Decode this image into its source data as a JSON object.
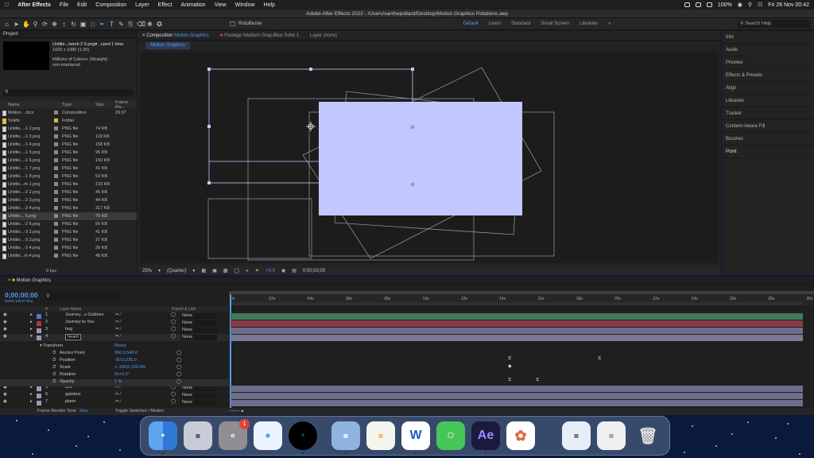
{
  "menubar": {
    "app_name": "After Effects",
    "items": [
      "File",
      "Edit",
      "Composition",
      "Layer",
      "Effect",
      "Animation",
      "View",
      "Window",
      "Help"
    ],
    "battery": "100%",
    "datetime": "Fri 26 Nov  00:42"
  },
  "window_title": "Adobe After Effects 2022 - /Users/xanthepollard/Desktop/Motion Graphics Rotations.aep",
  "toolbar": {
    "rotobezier_label": "RotoBezier",
    "workspaces": [
      {
        "label": "Default",
        "active": true
      },
      {
        "label": "Learn",
        "active": false
      },
      {
        "label": "Standard",
        "active": false
      },
      {
        "label": "Small Screen",
        "active": false
      },
      {
        "label": "Libraries",
        "active": false
      }
    ],
    "search_placeholder": "Search Help"
  },
  "project": {
    "title": "Project",
    "selected_name": "Untitle...twork-2 5.png▾ , used 1 time",
    "info_line1": "1920 x 1080 (1.00)",
    "info_line2": "Millions of Colors+ (Straight)",
    "info_line3": "non-interlaced",
    "columns": {
      "name": "Name",
      "type": "Type",
      "size": "Size",
      "frame": "Frame Ra..."
    },
    "bpc": "8 bpc",
    "items": [
      {
        "name": "Motion ...hics",
        "type": "Composition",
        "size": "",
        "frame": "29.97",
        "color": "#8a8a8a",
        "kind": "comp"
      },
      {
        "name": "Solids",
        "type": "Folder",
        "size": "",
        "frame": "",
        "color": "#d9c04a",
        "kind": "folder"
      },
      {
        "name": "Untitle...-1 2.png",
        "type": "PNG file",
        "size": "74 KB",
        "frame": "",
        "color": "#8a8a8a",
        "kind": "file"
      },
      {
        "name": "Untitle...-1 3.png",
        "type": "PNG file",
        "size": "119 KB",
        "frame": "",
        "color": "#8a8a8a",
        "kind": "file"
      },
      {
        "name": "Untitle...-1 4.png",
        "type": "PNG file",
        "size": "158 KB",
        "frame": "",
        "color": "#8a8a8a",
        "kind": "file"
      },
      {
        "name": "Untitle...-1 5.png",
        "type": "PNG file",
        "size": "95 KB",
        "frame": "",
        "color": "#8a8a8a",
        "kind": "file"
      },
      {
        "name": "Untitle...-1 6.png",
        "type": "PNG file",
        "size": "150 KB",
        "frame": "",
        "color": "#8a8a8a",
        "kind": "file"
      },
      {
        "name": "Untitle...-1 7.png",
        "type": "PNG file",
        "size": "41 KB",
        "frame": "",
        "color": "#8a8a8a",
        "kind": "file"
      },
      {
        "name": "Untitle...-1 8.png",
        "type": "PNG file",
        "size": "53 KB",
        "frame": "",
        "color": "#8a8a8a",
        "kind": "file"
      },
      {
        "name": "Untitle...rk-1.png",
        "type": "PNG file",
        "size": "133 KB",
        "frame": "",
        "color": "#8a8a8a",
        "kind": "file"
      },
      {
        "name": "Untitle...-2 2.png",
        "type": "PNG file",
        "size": "45 KB",
        "frame": "",
        "color": "#8a8a8a",
        "kind": "file"
      },
      {
        "name": "Untitle...-2 3.png",
        "type": "PNG file",
        "size": "44 KB",
        "frame": "",
        "color": "#8a8a8a",
        "kind": "file"
      },
      {
        "name": "Untitle...-2 4.png",
        "type": "PNG file",
        "size": "317 KB",
        "frame": "",
        "color": "#8a8a8a",
        "kind": "file"
      },
      {
        "name": "Untitle... 5.png",
        "type": "PNG file",
        "size": "70 KB",
        "frame": "",
        "color": "#8a8a8a",
        "kind": "file",
        "selected": true
      },
      {
        "name": "Untitle...-2 6.png",
        "type": "PNG file",
        "size": "66 KB",
        "frame": "",
        "color": "#8a8a8a",
        "kind": "file"
      },
      {
        "name": "Untitle...-3 2.png",
        "type": "PNG file",
        "size": "41 KB",
        "frame": "",
        "color": "#8a8a8a",
        "kind": "file"
      },
      {
        "name": "Untitle...-3 3.png",
        "type": "PNG file",
        "size": "37 KB",
        "frame": "",
        "color": "#8a8a8a",
        "kind": "file"
      },
      {
        "name": "Untitle...-3 4.png",
        "type": "PNG file",
        "size": "39 KB",
        "frame": "",
        "color": "#8a8a8a",
        "kind": "file"
      },
      {
        "name": "Untitle...rk-4.png",
        "type": "PNG file",
        "size": "48 KB",
        "frame": "",
        "color": "#8a8a8a",
        "kind": "file"
      }
    ]
  },
  "composition_panel": {
    "tab_prefix": "Composition",
    "tab_name": "Motion Graphics",
    "footage_tab": "Footage Medium Gray-Blue Solid 1",
    "layer_tab": "Layer (none)",
    "subtab": "Motion Graphics",
    "zoom": "25%",
    "resolution": "(Quarter)",
    "exposure": "+0.0",
    "timecode": "0;00;00;00",
    "solid_color": "#c2c8ff"
  },
  "right_panels": [
    {
      "label": "Info",
      "active": false
    },
    {
      "label": "Audio",
      "active": false
    },
    {
      "label": "Preview",
      "active": false
    },
    {
      "label": "Effects & Presets",
      "active": false
    },
    {
      "label": "Align",
      "active": false
    },
    {
      "label": "Libraries",
      "active": false
    },
    {
      "label": "Tracker",
      "active": false
    },
    {
      "label": "Content-Aware Fill",
      "active": false
    },
    {
      "label": "Brushes",
      "active": false
    },
    {
      "label": "Point",
      "active": true
    }
  ],
  "timeline": {
    "title": "Motion Graphics",
    "timecode": "0;00;00;00",
    "timecode_sub": "00000 (29.97 fps)",
    "col_layer_name": "Layer Name",
    "col_parent": "Parent & Link",
    "ruler_ticks": [
      "0s",
      "02s",
      "04s",
      "06s",
      "08s",
      "10s",
      "12s",
      "14s",
      "16s",
      "18s",
      "20s",
      "22s",
      "24s",
      "26s",
      "28s",
      "30s"
    ],
    "layers": [
      {
        "num": "1",
        "name": "Journey...u Outlines",
        "parent": "None",
        "label_color": "#5a6fd6",
        "bar_color": "#3f7a5a"
      },
      {
        "num": "2",
        "name": "Journey to You",
        "parent": "None",
        "label_color": "#b03a3a",
        "bar_color": "#8a3a48"
      },
      {
        "num": "3",
        "name": "hug",
        "parent": "None",
        "label_color": "#9a9ab8",
        "bar_color": "#6e6e8c"
      },
      {
        "num": "4",
        "name": "heartt",
        "parent": "None",
        "label_color": "#9a9ab8",
        "bar_color": "#7a7a96"
      },
      {
        "num": "5",
        "name": "831",
        "parent": "None",
        "label_color": "#9a9ab8",
        "bar_color": "#6e6e8c"
      },
      {
        "num": "6",
        "name": "gatebox",
        "parent": "None",
        "label_color": "#9a9ab8",
        "bar_color": "#6e6e8c"
      },
      {
        "num": "7",
        "name": "plane",
        "parent": "None",
        "label_color": "#9a9ab8",
        "bar_color": "#6e6e8c"
      }
    ],
    "transform_label": "Transform",
    "reset_label": "Reset",
    "properties": [
      {
        "name": "Anchor Point",
        "value": "960.0,540.0"
      },
      {
        "name": "Position",
        "value": "-80.0,235.0"
      },
      {
        "name": "Scale",
        "value": "∞ 100.0,100.0%"
      },
      {
        "name": "Rotation",
        "value": "0x+0.0°"
      },
      {
        "name": "Opacity",
        "value": "1 %"
      }
    ],
    "footer_render": "Frame Render Time",
    "footer_render_value": "2ms",
    "footer_toggle": "Toggle Switches / Modes"
  },
  "dock": {
    "notification_badge": "1",
    "ae_label": "Ae",
    "word_label": "W"
  }
}
